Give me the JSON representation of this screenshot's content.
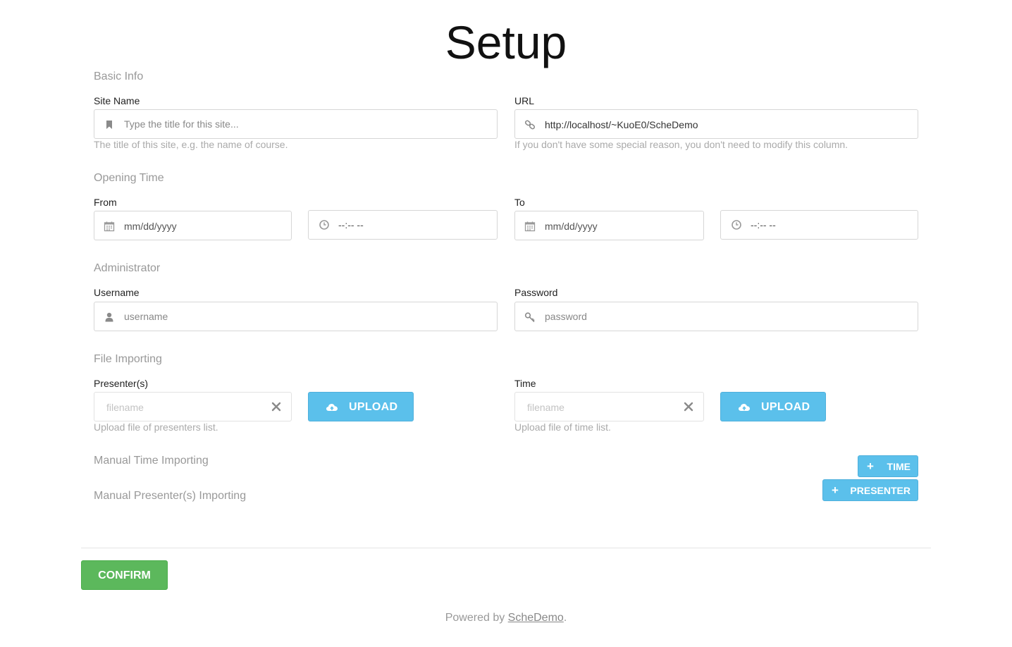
{
  "page": {
    "title": "Setup"
  },
  "basic_info": {
    "heading": "Basic Info",
    "site_name": {
      "label": "Site Name",
      "placeholder": "Type the title for this site...",
      "help": "The title of this site, e.g. the name of course.",
      "icon": "bookmark-icon"
    },
    "url": {
      "label": "URL",
      "value": "http://localhost/~KuoE0/ScheDemo",
      "help": "If you don't have some special reason, you don't need to modify this column.",
      "icon": "link-icon"
    }
  },
  "opening_time": {
    "heading": "Opening Time",
    "from": {
      "label": "From",
      "date_value": "mm/dd/yyyy",
      "time_value": "--:-- --"
    },
    "to": {
      "label": "To",
      "date_value": "mm/dd/yyyy",
      "time_value": "--:-- --"
    }
  },
  "administrator": {
    "heading": "Administrator",
    "username": {
      "label": "Username",
      "placeholder": "username",
      "icon": "user-icon"
    },
    "password": {
      "label": "Password",
      "placeholder": "password",
      "icon": "key-icon"
    }
  },
  "file_importing": {
    "heading": "File Importing",
    "presenters": {
      "label": "Presenter(s)",
      "placeholder": "filename",
      "upload_label": "UPLOAD",
      "help": "Upload file of presenters list."
    },
    "time": {
      "label": "Time",
      "placeholder": "filename",
      "upload_label": "UPLOAD",
      "help": "Upload file of time list."
    }
  },
  "manual": {
    "time_heading": "Manual Time Importing",
    "presenter_heading": "Manual Presenter(s) Importing",
    "add_time_label": "TIME",
    "add_presenter_label": "PRESENTER",
    "plus": "+"
  },
  "actions": {
    "confirm_label": "CONFIRM"
  },
  "footer": {
    "prefix": "Powered by ",
    "link_text": "ScheDemo",
    "suffix": "."
  },
  "colors": {
    "accent": "#5bc0eb",
    "confirm": "#5cb85c",
    "muted_text": "#999999"
  }
}
